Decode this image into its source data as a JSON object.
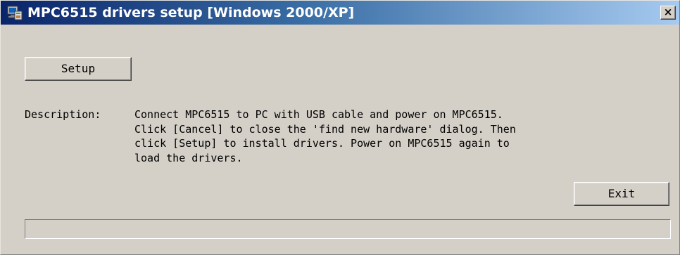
{
  "window": {
    "title": "MPC6515 drivers setup [Windows 2000/XP]",
    "icon": "setup-computer-icon",
    "close_label": "×"
  },
  "buttons": {
    "setup_label": "Setup",
    "exit_label": "Exit"
  },
  "description": {
    "label": "Description:",
    "lines": [
      "Connect MPC6515 to PC with USB cable and power on MPC6515.",
      "Click [Cancel] to close the 'find new hardware' dialog. Then",
      "click [Setup] to install drivers. Power on MPC6515 again to",
      "load the drivers."
    ]
  },
  "progress": {
    "value": 0
  },
  "colors": {
    "titlebar_start": "#0a246a",
    "titlebar_end": "#a6caf0",
    "face": "#d4d0c8"
  }
}
